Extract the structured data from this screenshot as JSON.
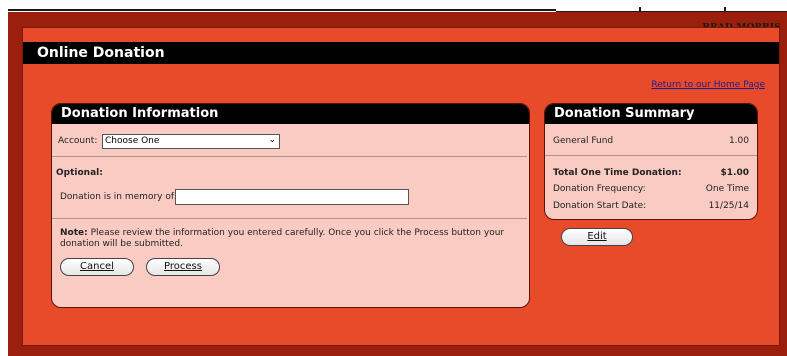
{
  "header": {
    "user_name": "BRAD MORRIS"
  },
  "page": {
    "title": "Online Donation",
    "home_link": "Return to our Home Page"
  },
  "donation_info": {
    "heading": "Donation Information",
    "account_label": "Account:",
    "account_selected": "Choose One",
    "optional_label": "Optional:",
    "memory_label": "Donation is in memory of",
    "memory_value": "",
    "note_label": "Note:",
    "note_text": "Please review the information you entered carefully. Once you click the Process button your donation will be submitted.",
    "cancel_label": "Cancel",
    "process_label": "Process"
  },
  "summary": {
    "heading": "Donation Summary",
    "fund_label": "General Fund",
    "fund_value": "1.00",
    "total_label": "Total One Time Donation:",
    "total_value": "$1.00",
    "frequency_label": "Donation Frequency:",
    "frequency_value": "One Time",
    "start_label": "Donation Start Date:",
    "start_value": "11/25/14",
    "edit_label": "Edit"
  },
  "colors": {
    "frame": "#9a1f0c",
    "page": "#e84b2a",
    "panel": "#f9cbc3",
    "header": "#000000"
  }
}
